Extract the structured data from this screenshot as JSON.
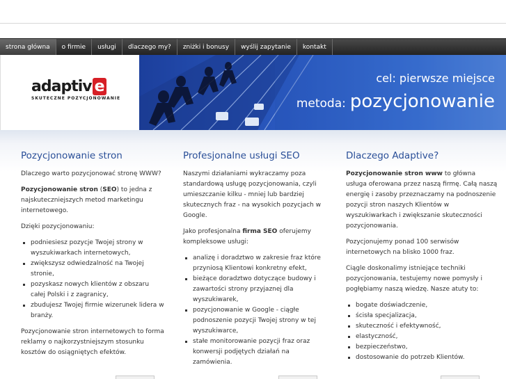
{
  "nav": {
    "items": [
      {
        "label": "strona główna"
      },
      {
        "label": "o firmie"
      },
      {
        "label": "usługi"
      },
      {
        "label": "dlaczego my?"
      },
      {
        "label": "zniżki i bonusy"
      },
      {
        "label": "wyślij zapytanie"
      },
      {
        "label": "kontakt"
      }
    ]
  },
  "logo": {
    "main": "adaptiv",
    "letter": "e",
    "tagline": "SKUTECZNE POZYCJONOWANIE"
  },
  "banner": {
    "cel": "cel: pierwsze miejsce",
    "metoda_label": "metoda:",
    "metoda_value": "pozycjonowanie"
  },
  "columns": [
    {
      "title": "Pozycjonowanie stron",
      "p1": "Dlaczego warto pozycjonować stronę WWW?",
      "p2_bold": "Pozycjonowanie stron",
      "p2_paren_open": " (",
      "p2_bold2": "SEO",
      "p2_rest": ") to jedna z najskuteczniejszych metod marketingu internetowego.",
      "p3": "Dzięki pozycjonowaniu:",
      "list": [
        "podniesiesz pozycje Twojej strony w wyszukiwarkach internetowych,",
        "zwiększysz odwiedzalność na Twojej stronie,",
        "pozyskasz nowych klientów z obszaru całej Polski i z zagranicy,",
        "zbudujesz Twojej firmie wizerunek lidera w branży."
      ],
      "p4": "Pozycjonowanie stron internetowych to forma reklamy o najkorzystniejszym stosunku kosztów do osiągniętych efektów."
    },
    {
      "title": "Profesjonalne usługi SEO",
      "p1": "Naszymi działaniami wykraczamy poza standardową usługę pozycjonowania, czyli umieszczanie kilku - mniej lub bardziej skutecznych fraz - na wysokich pozycjach w Google.",
      "p2_pre": "Jako profesjonalna ",
      "p2_bold": "firma SEO",
      "p2_rest": " oferujemy kompleksowe usługi:",
      "list": [
        "analizę i doradztwo w zakresie fraz które przyniosą Klientowi konkretny efekt,",
        "bieżące doradztwo dotyczące budowy i zawartości strony przyjaznej dla wyszukiwarek,",
        "pozycjonowanie w Google - ciągłe podnoszenie pozycji Twojej strony w tej wyszukiwarce,",
        "stałe monitorowanie pozycji fraz oraz konwersji podjętych działań na zamówienia."
      ]
    },
    {
      "title": "Dlaczego Adaptive?",
      "p1_bold": "Pozycjonowanie stron www",
      "p1_rest": " to główna usługa oferowana przez naszą firmę. Całą naszą energię i zasoby przeznaczamy na podnoszenie pozycji stron naszych Klientów w wyszukiwarkach i zwiększanie skuteczności pozycjonowania.",
      "p2": "Pozycjonujemy ponad 100 serwisów internetowych na blisko 1000 fraz.",
      "p3": "Ciągle doskonalimy istniejące techniki pozycjonowania, testujemy nowe pomysły i pogłębiamy naszą wiedzę. Nasze atuty to:",
      "list": [
        "bogate doświadczenie,",
        "ścisła specjalizacja,",
        "skuteczność i efektywność,",
        "elastyczność,",
        "bezpieczeństwo,",
        "dostosowanie do potrzeb Klientów."
      ]
    }
  ]
}
